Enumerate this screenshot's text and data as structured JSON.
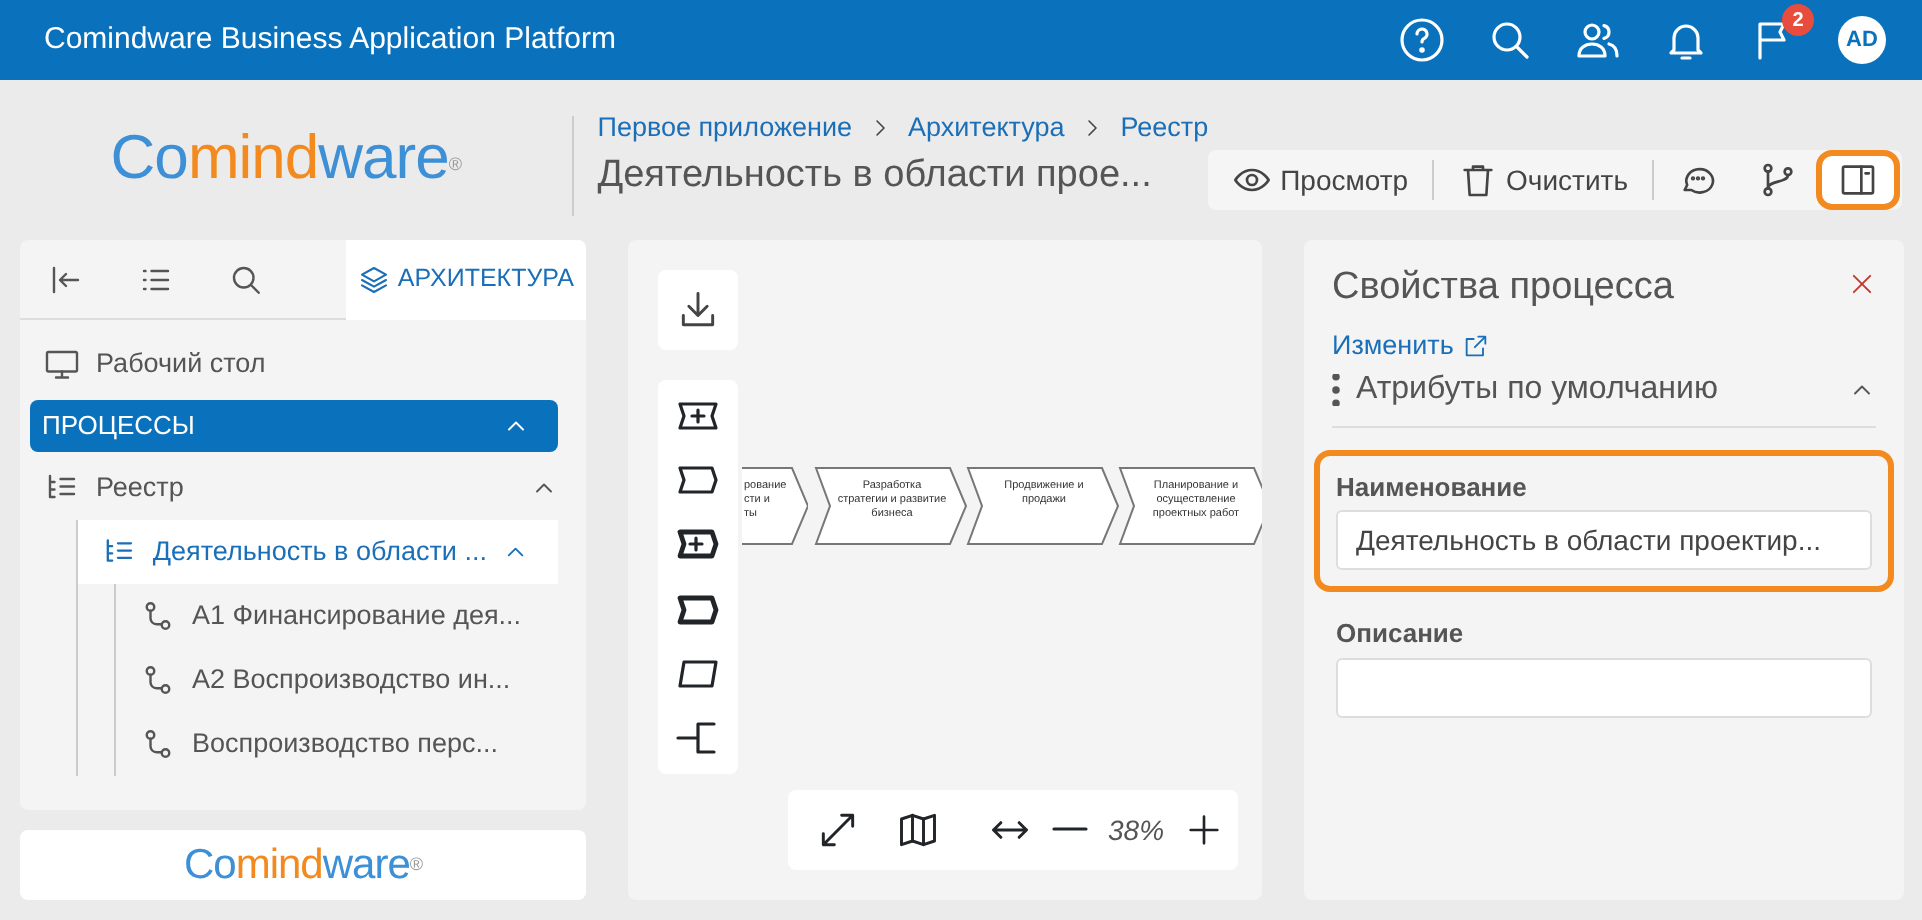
{
  "app_bar": {
    "title": "Comindware Business Application Platform",
    "notification_count": "2",
    "user_initials": "AD"
  },
  "logo": {
    "parts": [
      {
        "text": "Co",
        "color": "#3d8fd6"
      },
      {
        "text": "mind",
        "color": "#f28a1f"
      },
      {
        "text": "ware",
        "color": "#3d8fd6"
      }
    ],
    "mark": "®"
  },
  "breadcrumb": [
    "Первое приложение",
    "Архитектура",
    "Реестр"
  ],
  "page_title": "Деятельность в области прое...",
  "toolbar": [
    {
      "kind": "view",
      "label": "Просмотр"
    },
    {
      "kind": "clear",
      "label": "Очистить"
    },
    {
      "kind": "comment"
    },
    {
      "kind": "branch"
    },
    {
      "kind": "panel",
      "selected": true
    }
  ],
  "sidebar": {
    "tabs": [
      {
        "kind": "collapse",
        "selected": false
      },
      {
        "kind": "list",
        "selected": false
      },
      {
        "kind": "search",
        "selected": false
      },
      {
        "kind": "layers",
        "label": "АРХИТЕКТУРА",
        "selected": true
      }
    ],
    "items": [
      {
        "kind": "desktop",
        "label": "Рабочий стол",
        "selected": false
      },
      {
        "kind": "group",
        "label": "ПРОЦЕССЫ",
        "selected": true,
        "expanded": true,
        "children": [
          {
            "kind": "registry",
            "label": "Реестр",
            "selected": false,
            "expanded": true,
            "children": [
              {
                "kind": "registry",
                "label": "Деятельность в области ...",
                "selected": true,
                "expanded": true,
                "children": [
                  {
                    "kind": "process",
                    "label": "А1 Финансирование дея...",
                    "selected": false
                  },
                  {
                    "kind": "process",
                    "label": "А2 Воспроизводство ин...",
                    "selected": false
                  },
                  {
                    "kind": "process",
                    "label": "Воспроизводство перс...",
                    "selected": false
                  }
                ]
              }
            ]
          }
        ]
      }
    ]
  },
  "diagram": {
    "steps": [
      {
        "lines": [
          "рование",
          "сти и",
          "ты"
        ],
        "cut": true
      },
      {
        "lines": [
          "Разработка",
          "стратегии и развитие",
          "бизнеса"
        ],
        "cut": false
      },
      {
        "lines": [
          "Продвижение и",
          "продажи"
        ],
        "cut": false
      },
      {
        "lines": [
          "Планирование и",
          "осуществление",
          "проектных работ"
        ],
        "cut": false
      }
    ],
    "zoom": "38%"
  },
  "footer_logo": {
    "parts": [
      {
        "text": "Co",
        "color": "#3d8fd6"
      },
      {
        "text": "mind",
        "color": "#f28a1f"
      },
      {
        "text": "ware",
        "color": "#3d8fd6"
      }
    ],
    "mark": "®"
  },
  "properties": {
    "title": "Свойства процесса",
    "edit_link": "Изменить",
    "section": {
      "label": "Атрибуты по умолчанию",
      "expanded": true
    },
    "fields": [
      {
        "label": "Наименование",
        "value": "Деятельность в области проектир...",
        "highlighted": true
      },
      {
        "label": "Описание",
        "highlighted": false
      }
    ]
  }
}
